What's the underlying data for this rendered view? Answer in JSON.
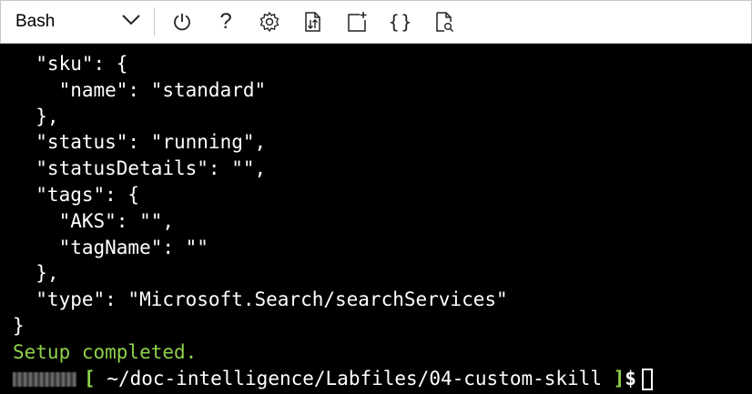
{
  "toolbar": {
    "shell": "Bash",
    "buttons": [
      {
        "icon": "power-icon"
      },
      {
        "icon": "help-icon",
        "glyph": "?"
      },
      {
        "icon": "settings-icon"
      },
      {
        "icon": "upload-download-icon"
      },
      {
        "icon": "new-session-icon"
      },
      {
        "icon": "braces-icon",
        "glyph": "{}"
      },
      {
        "icon": "preview-icon"
      }
    ]
  },
  "terminal": {
    "lines": [
      "  \"sku\": {",
      "    \"name\": \"standard\"",
      "  },",
      "  \"status\": \"running\",",
      "  \"statusDetails\": \"\",",
      "  \"tags\": {",
      "    \"AKS\": \"\",",
      "    \"tagName\": \"\"",
      "  },",
      "  \"type\": \"Microsoft.Search/searchServices\"",
      "}"
    ],
    "status_line": "Setup completed.",
    "prompt": {
      "open_bracket": "[",
      "cwd": "~/doc-intelligence/Labfiles/04-custom-skill",
      "close_bracket": "]",
      "symbol": "$"
    }
  },
  "colors": {
    "terminal_bg": "#000000",
    "terminal_fg": "#ffffff",
    "accent_green": "#8ed14b",
    "toolbar_bg": "#ffffff"
  }
}
